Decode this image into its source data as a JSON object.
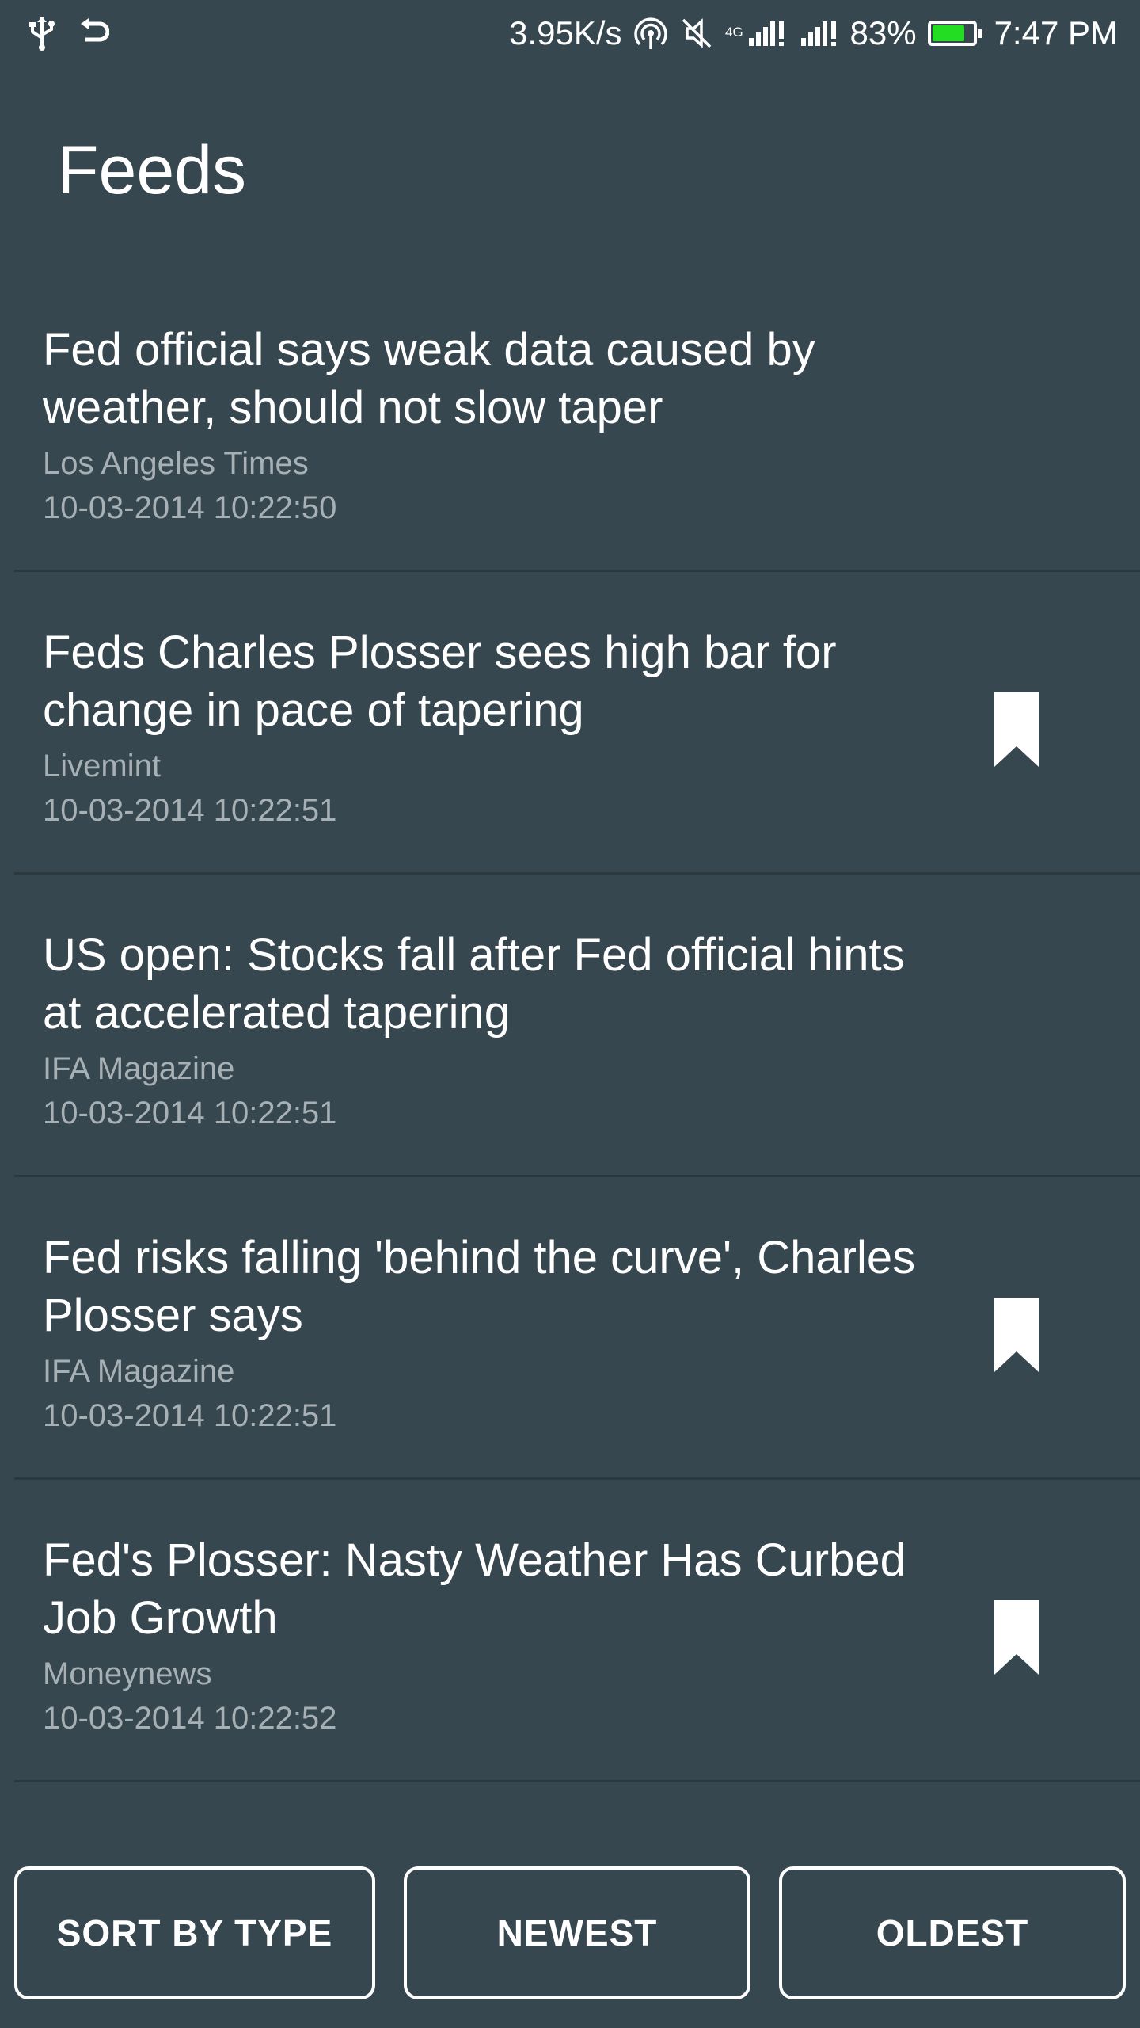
{
  "status_bar": {
    "left_icons": [
      "usb-icon",
      "back-arrow-icon"
    ],
    "network_speed": "3.95K/s",
    "network_type": "4G",
    "battery_percent_text": "83%",
    "battery_level": 0.83,
    "battery_color": "#22dd22",
    "time": "7:47 PM",
    "right_icons": [
      "hotspot-icon",
      "mute-icon",
      "signal-icon",
      "signal-icon",
      "battery-icon"
    ]
  },
  "page": {
    "title": "Feeds",
    "background_color": "#37474f"
  },
  "feeds": [
    {
      "title": "Fed official says weak data caused by weather, should not slow taper",
      "source": "Los Angeles Times",
      "timestamp": "10-03-2014 10:22:50",
      "bookmarked": false
    },
    {
      "title": "Feds Charles Plosser sees high bar for change in pace of tapering",
      "source": "Livemint",
      "timestamp": "10-03-2014 10:22:51",
      "bookmarked": true
    },
    {
      "title": "US open: Stocks fall after Fed official hints at accelerated tapering",
      "source": "IFA Magazine",
      "timestamp": "10-03-2014 10:22:51",
      "bookmarked": false
    },
    {
      "title": "Fed risks falling 'behind the curve', Charles Plosser says",
      "source": "IFA Magazine",
      "timestamp": "10-03-2014 10:22:51",
      "bookmarked": true
    },
    {
      "title": "Fed's Plosser: Nasty Weather Has Curbed Job Growth",
      "source": "Moneynews",
      "timestamp": "10-03-2014 10:22:52",
      "bookmarked": true
    }
  ],
  "sort_buttons": {
    "sort_by_type": "SORT BY TYPE",
    "newest": "NEWEST",
    "oldest": "OLDEST"
  }
}
